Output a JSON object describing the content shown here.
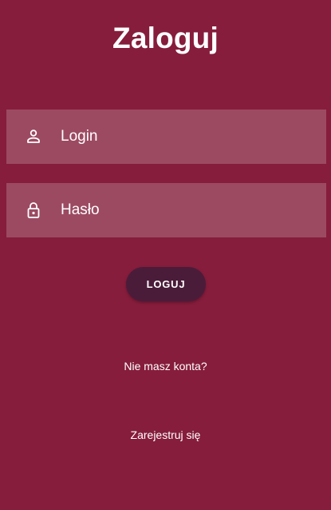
{
  "screen": {
    "title": "Zaloguj"
  },
  "login_form": {
    "login_field": {
      "placeholder": "Login",
      "value": "",
      "icon": "person-icon"
    },
    "password_field": {
      "placeholder": "Hasło",
      "value": "",
      "icon": "lock-icon"
    },
    "submit_label": "LOGUJ"
  },
  "footer": {
    "no_account_text": "Nie masz konta?",
    "register_label": "Zarejestruj się"
  },
  "colors": {
    "background": "#861D3C",
    "field_background": "#9C4A62",
    "button_background": "#4A1C3A",
    "text": "#FFFFFF"
  }
}
